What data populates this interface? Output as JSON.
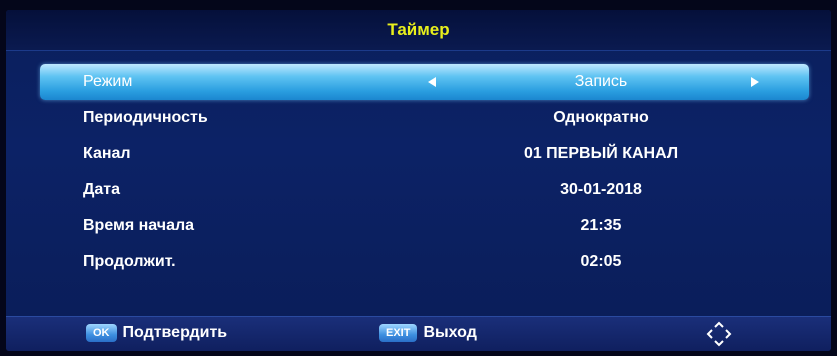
{
  "title": "Таймер",
  "selected_row": {
    "label": "Режим",
    "value": "Запись"
  },
  "rows": [
    {
      "label": "Периодичность",
      "value": "Однократно"
    },
    {
      "label": "Канал",
      "value": "01 ПЕРВЫЙ КАНАЛ"
    },
    {
      "label": "Дата",
      "value": "30-01-2018"
    },
    {
      "label": "Время начала",
      "value": "21:35"
    },
    {
      "label": "Продолжит.",
      "value": "02:05"
    }
  ],
  "footer": {
    "ok_key": "OK",
    "ok_label": "Подтвердить",
    "exit_key": "EXIT",
    "exit_label": "Выход",
    "nav_icon": "navigation-arrows-icon"
  },
  "colors": {
    "title": "#e8ef1c",
    "highlight": "#3aa8e8",
    "panel": "#0c2266"
  }
}
